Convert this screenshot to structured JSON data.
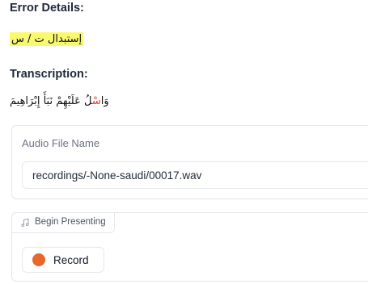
{
  "error_details": {
    "heading": "Error Details:",
    "text": "إستبدال ت / س"
  },
  "transcription": {
    "heading": "Transcription:",
    "prefix": "وَا",
    "highlight": "سْ",
    "suffix": "لُ عَلَيْهِمْ نَبَأَ إِبْرَاهِيمَ"
  },
  "audio_file": {
    "label": "Audio File Name",
    "value": "recordings/-None-saudi/00017.wav"
  },
  "recorder": {
    "tab_label": "Begin Presenting",
    "tab_icon": "music-note-icon",
    "record_label": "Record",
    "record_color": "#e8672a"
  }
}
